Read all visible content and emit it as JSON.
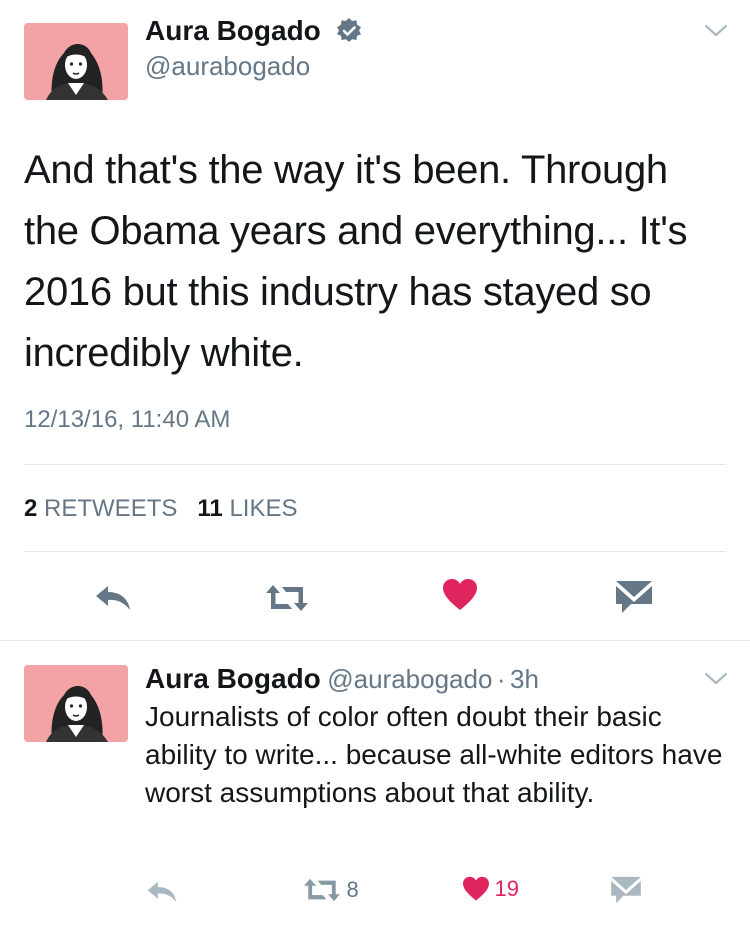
{
  "main_tweet": {
    "author_name": "Aura Bogado",
    "author_handle": "@aurabogado",
    "verified": true,
    "text": "And that's the way it's been. Through the Obama years and everything... It's 2016 but this industry has stayed so incredibly white.",
    "timestamp": "12/13/16, 11:40 AM",
    "retweet_count": "2",
    "retweet_label": "RETWEETS",
    "like_count": "11",
    "like_label": "LIKES"
  },
  "reply_tweet": {
    "author_name": "Aura Bogado",
    "author_handle": "@aurabogado",
    "separator": "·",
    "age": "3h",
    "text": "Journalists of color often doubt their basic ability to write... because all-white editors have worst assumptions about that ability.",
    "retweet_count": "8",
    "like_count": "19"
  },
  "colors": {
    "avatar_bg": "#f3a3a6",
    "like": "#e0245e",
    "icon": "#8899a6",
    "verified": "#657786"
  },
  "icons": [
    "verified-badge-icon",
    "chevron-down-icon",
    "reply-icon",
    "retweet-icon",
    "heart-icon",
    "direct-message-icon"
  ]
}
